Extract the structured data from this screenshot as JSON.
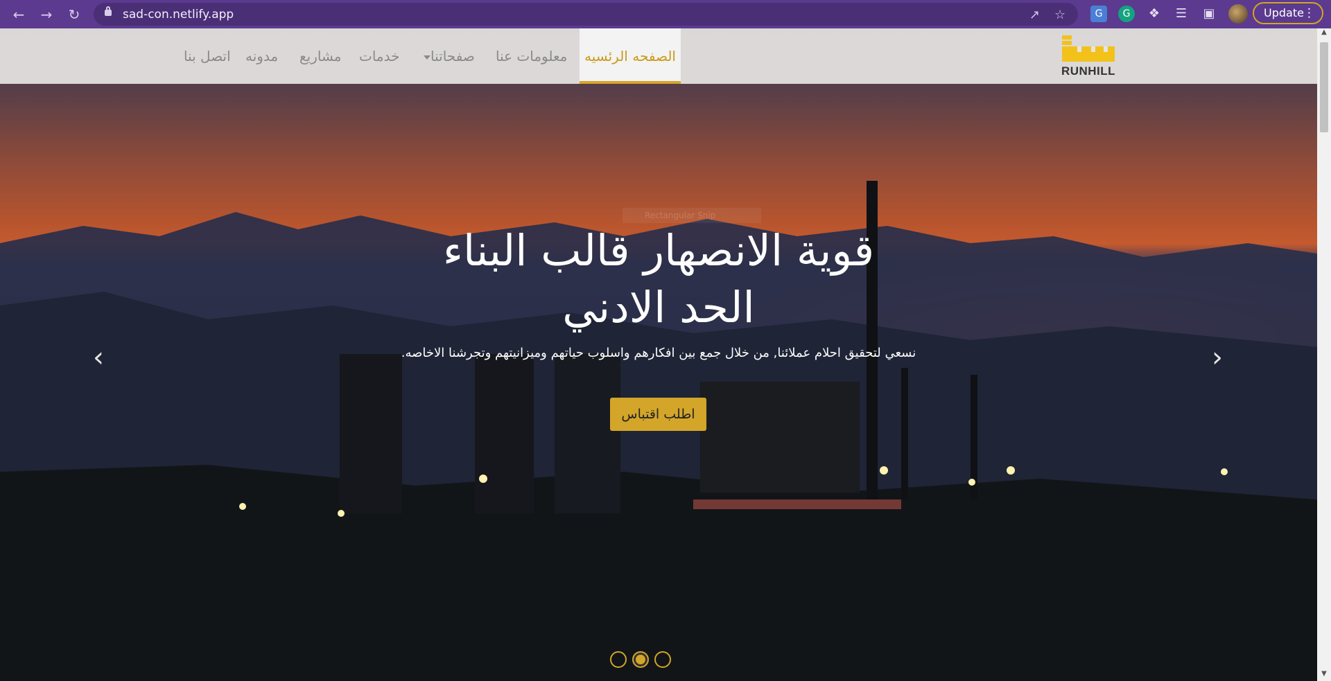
{
  "browser": {
    "url": "sad-con.netlify.app",
    "update_label": "Update"
  },
  "navbar": {
    "logo_text": "RUNHILL",
    "items": [
      {
        "label": "الصفحه الرئسيه",
        "active": true
      },
      {
        "label": "معلومات عنا"
      },
      {
        "label": "صفحاتنا",
        "dropdown": true
      },
      {
        "label": "خدمات"
      },
      {
        "label": "مشاريع"
      },
      {
        "label": "مدونه"
      },
      {
        "label": "اتصل بنا"
      }
    ]
  },
  "hero": {
    "headline_line1": "قوية الانصهار قالب البناء",
    "headline_line2": "الحد الادني",
    "subtitle": "نسعي لتحقيق احلام عملائنا, من خلال جمع بين افكارهم واسلوب حياتهم وميزانيتهم وتجرشنا الاخاصه.",
    "cta_label": "اطلب اقتباس",
    "ghost_text": "Rectangular Snip"
  },
  "carousel": {
    "slide_count": 3,
    "active_slide": 2,
    "prev_icon": "chevron-left-icon",
    "next_icon": "chevron-right-icon"
  },
  "colors": {
    "accent": "#d3a529",
    "browser_bar": "#5b3a8f"
  }
}
